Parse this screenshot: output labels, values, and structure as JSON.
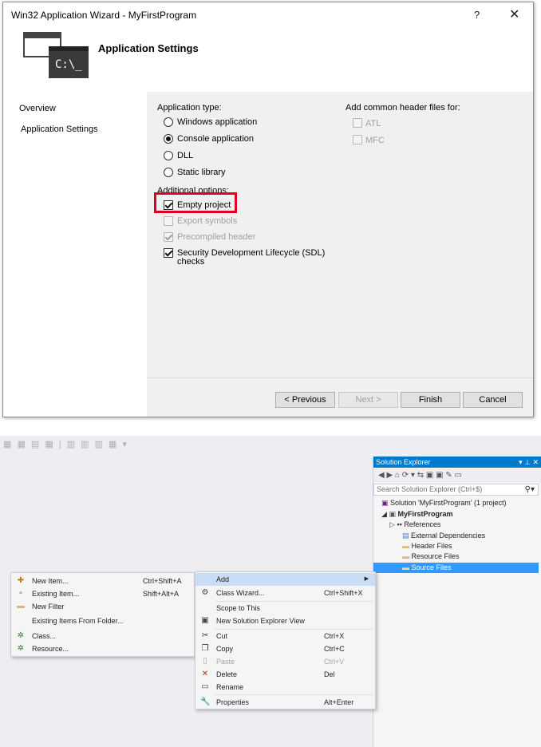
{
  "wizard": {
    "title": "Win32 Application Wizard - MyFirstProgram",
    "help": "?",
    "close": "✕",
    "banner_title": "Application Settings",
    "banner_icon_text": "C:\\_",
    "nav": [
      "Overview",
      "Application Settings"
    ],
    "app_type_label": "Application type:",
    "app_types": [
      {
        "label": "Windows application",
        "selected": false
      },
      {
        "label": "Console application",
        "selected": true
      },
      {
        "label": "DLL",
        "selected": false
      },
      {
        "label": "Static library",
        "selected": false
      }
    ],
    "additional_label": "Additional options:",
    "options": [
      {
        "label": "Empty project",
        "checked": true,
        "enabled": true
      },
      {
        "label": "Export symbols",
        "checked": false,
        "enabled": false
      },
      {
        "label": "Precompiled header",
        "checked": true,
        "enabled": false
      },
      {
        "label": "Security Development Lifecycle (SDL)",
        "label2": "checks",
        "checked": true,
        "enabled": true
      }
    ],
    "header_label": "Add common header files for:",
    "headers": [
      {
        "label": "ATL",
        "checked": false
      },
      {
        "label": "MFC",
        "checked": false
      }
    ],
    "buttons": {
      "previous": "< Previous",
      "next": "Next >",
      "finish": "Finish",
      "cancel": "Cancel"
    },
    "highlight_color": "#e0001b"
  },
  "solution_explorer": {
    "title": "Solution Explorer",
    "title_buttons": "▾ ⊥ ✕",
    "search_placeholder": "Search Solution Explorer (Ctrl+$)",
    "tree": [
      {
        "label": "Solution 'MyFirstProgram' (1 project)",
        "icon": "solution-icon"
      },
      {
        "label": "MyFirstProgram",
        "icon": "project-icon",
        "bold": true
      },
      {
        "label": "References",
        "icon": "references-icon"
      },
      {
        "label": "External Dependencies",
        "icon": "dependencies-icon"
      },
      {
        "label": "Header Files",
        "icon": "folder-icon"
      },
      {
        "label": "Resource Files",
        "icon": "folder-icon"
      },
      {
        "label": "Source Files",
        "icon": "folder-icon",
        "selected": true
      }
    ],
    "accent": "#007acc"
  },
  "add_submenu": [
    {
      "label": "New Item...",
      "shortcut": "Ctrl+Shift+A",
      "icon": "new-item-icon"
    },
    {
      "label": "Existing Item...",
      "shortcut": "Shift+Alt+A",
      "icon": "existing-item-icon"
    },
    {
      "label": "New Filter",
      "shortcut": "",
      "icon": "filter-folder-icon"
    },
    {
      "label": "Existing Items From Folder...",
      "shortcut": "",
      "icon": ""
    },
    {
      "label": "Class...",
      "shortcut": "",
      "icon": "class-icon"
    },
    {
      "label": "Resource...",
      "shortcut": "",
      "icon": "resource-icon"
    }
  ],
  "context_menu": [
    {
      "label": "Add",
      "shortcut": "",
      "icon": "",
      "hot": true
    },
    {
      "label": "Class Wizard...",
      "shortcut": "Ctrl+Shift+X",
      "icon": "class-wizard-icon"
    },
    {
      "label": "Scope to This",
      "shortcut": "",
      "icon": ""
    },
    {
      "label": "New Solution Explorer View",
      "shortcut": "",
      "icon": "new-view-icon"
    },
    {
      "label": "Cut",
      "shortcut": "Ctrl+X",
      "icon": "cut-icon"
    },
    {
      "label": "Copy",
      "shortcut": "Ctrl+C",
      "icon": "copy-icon"
    },
    {
      "label": "Paste",
      "shortcut": "Ctrl+V",
      "icon": "paste-icon",
      "disabled": true
    },
    {
      "label": "Delete",
      "shortcut": "Del",
      "icon": "delete-icon"
    },
    {
      "label": "Rename",
      "shortcut": "",
      "icon": "rename-icon"
    },
    {
      "label": "Properties",
      "shortcut": "Alt+Enter",
      "icon": "properties-icon"
    }
  ]
}
